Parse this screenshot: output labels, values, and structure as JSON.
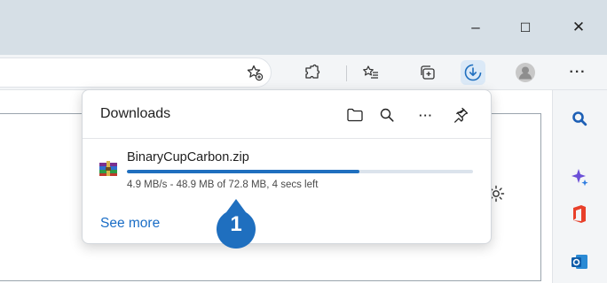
{
  "window": {
    "minimize_glyph": "–",
    "maximize_glyph": "☐",
    "close_glyph": "✕"
  },
  "toolbar": {
    "icons": [
      "favorite-add-icon",
      "extensions-icon",
      "favorites-icon",
      "collections-icon",
      "downloads-icon",
      "profile-avatar-icon",
      "more-icon"
    ],
    "more_label": "···"
  },
  "downloads": {
    "title": "Downloads",
    "header_icons": [
      "open-folder-icon",
      "search-icon",
      "more-icon",
      "pin-icon"
    ],
    "more_label": "···",
    "file_name": "BinaryCupCarbon.zip",
    "progress_fraction": 0.6717,
    "status": "4.9 MB/s - 48.9 MB of 72.8 MB, 4 secs left",
    "see_more": "See more"
  },
  "callout": {
    "number": "1",
    "color": "#1f6fbf"
  },
  "sidebar": {
    "icons": [
      "search-icon",
      "copilot-icon",
      "office-icon",
      "outlook-icon"
    ]
  },
  "colors": {
    "titlebar": "#d6dfe6",
    "accent": "#1f6fbf",
    "link": "#1a6dc6"
  }
}
